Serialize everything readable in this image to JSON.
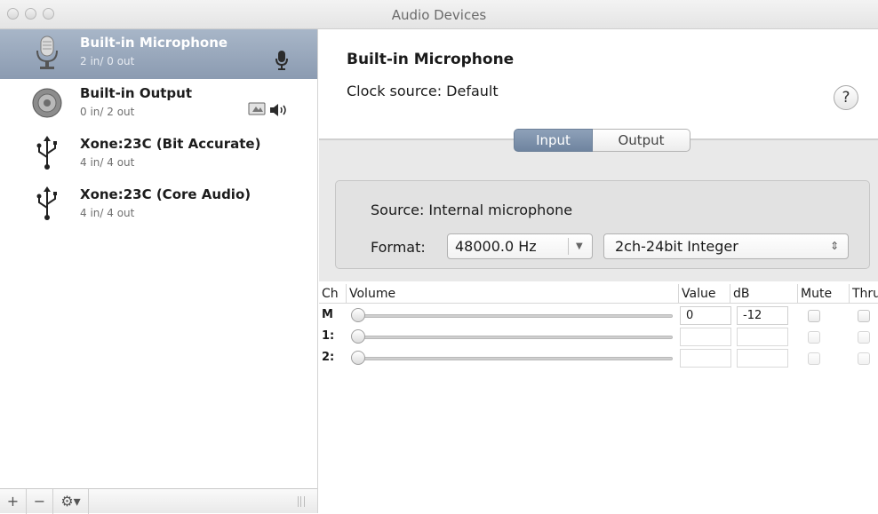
{
  "window": {
    "title": "Audio Devices"
  },
  "sidebar": {
    "devices": [
      {
        "name": "Built-in Microphone",
        "io": "2 in/ 0 out",
        "icon": "microphone-icon",
        "selected": true
      },
      {
        "name": "Built-in Output",
        "io": "0 in/ 2 out",
        "icon": "speaker-icon",
        "selected": false
      },
      {
        "name": "Xone:23C (Bit Accurate)",
        "io": "4 in/ 4 out",
        "icon": "usb-icon",
        "selected": false
      },
      {
        "name": "Xone:23C (Core Audio)",
        "io": "4 in/ 4 out",
        "icon": "usb-icon",
        "selected": false
      }
    ],
    "bottom": {
      "add": "+",
      "remove": "−",
      "action": "⚙▾"
    }
  },
  "detail": {
    "name": "Built-in Microphone",
    "clock": "Clock source:  Default",
    "help": "?",
    "tabs": {
      "input": "Input",
      "output": "Output",
      "active": "input"
    },
    "source": "Source:  Internal microphone",
    "format_label": "Format:",
    "sample_rate": "48000.0 Hz",
    "bit_format": "2ch-24bit Integer"
  },
  "table": {
    "headers": {
      "ch": "Ch",
      "volume": "Volume",
      "value": "Value",
      "db": "dB",
      "mute": "Mute",
      "thru": "Thru"
    },
    "rows": [
      {
        "ch": "M",
        "value": "0",
        "db": "-12"
      },
      {
        "ch": "1:",
        "value": "",
        "db": ""
      },
      {
        "ch": "2:",
        "value": "",
        "db": ""
      }
    ]
  },
  "colors": {
    "selection": "#8b9bb1",
    "segment_active": "#7a8ea8"
  }
}
